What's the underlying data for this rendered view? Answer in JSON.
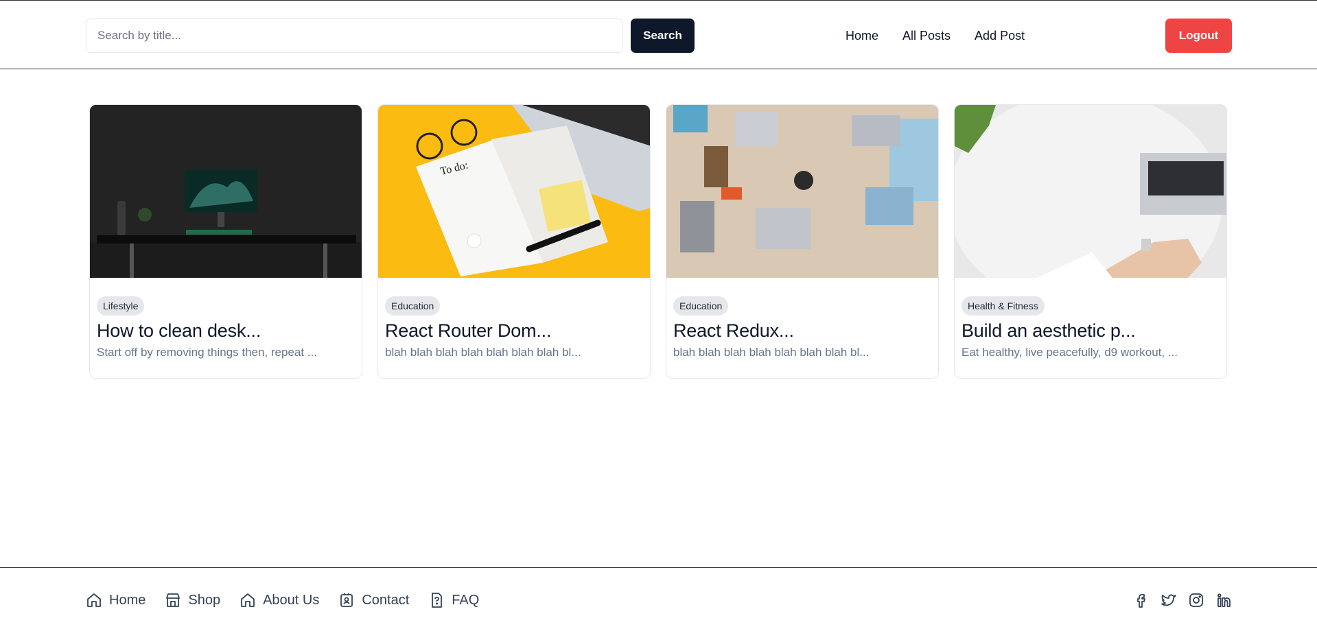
{
  "header": {
    "search_placeholder": "Search by title...",
    "search_label": "Search",
    "nav": [
      "Home",
      "All Posts",
      "Add Post"
    ],
    "logout_label": "Logout"
  },
  "posts": [
    {
      "category": "Lifestyle",
      "title": "How to clean desk...",
      "excerpt": "Start off by removing things then, repeat ..."
    },
    {
      "category": "Education",
      "title": "React Router Dom...",
      "excerpt": "blah blah blah blah blah blah blah bl..."
    },
    {
      "category": "Education",
      "title": "React Redux...",
      "excerpt": "blah blah blah blah blah blah blah bl..."
    },
    {
      "category": "Health & Fitness",
      "title": "Build an aesthetic p...",
      "excerpt": "Eat healthy, live peacefully, d9 workout, ..."
    }
  ],
  "footer": {
    "links": [
      {
        "label": "Home",
        "icon": "home-icon"
      },
      {
        "label": "Shop",
        "icon": "shop-icon"
      },
      {
        "label": "About Us",
        "icon": "home-icon"
      },
      {
        "label": "Contact",
        "icon": "contact-icon"
      },
      {
        "label": "FAQ",
        "icon": "faq-icon"
      }
    ],
    "socials": [
      "facebook-icon",
      "twitter-icon",
      "instagram-icon",
      "linkedin-icon"
    ]
  },
  "colors": {
    "primary": "#0f172a",
    "danger": "#ef4444",
    "muted": "#64748b",
    "tag_bg": "#e5e7eb"
  }
}
